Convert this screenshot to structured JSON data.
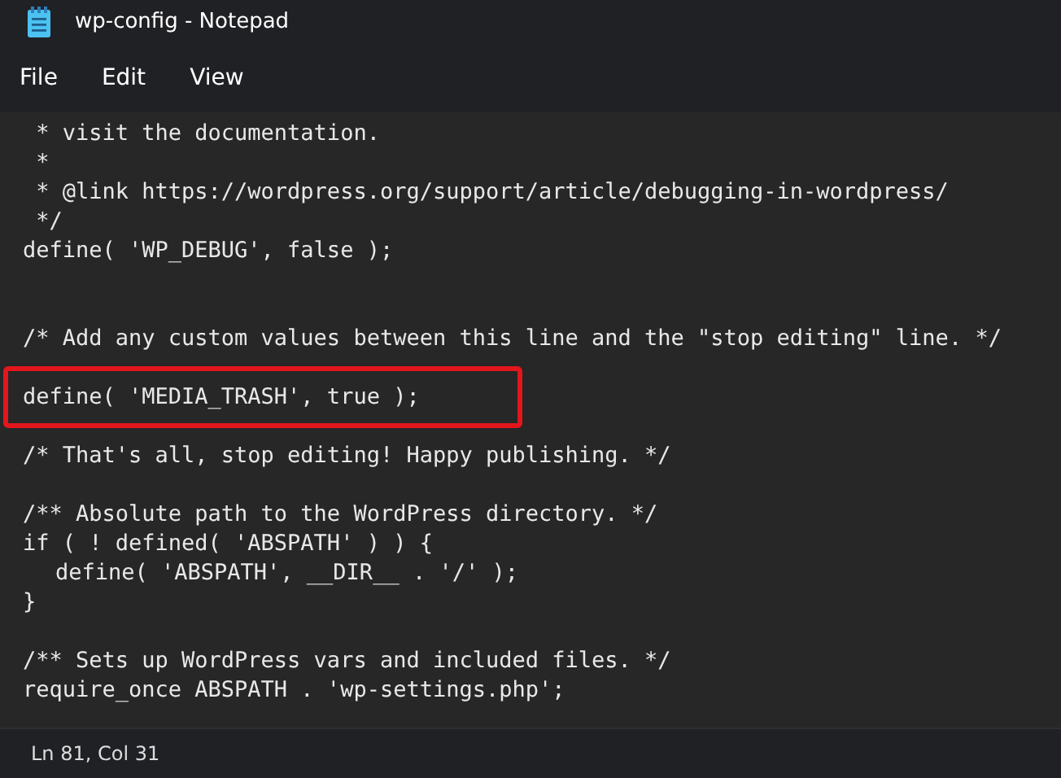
{
  "window": {
    "title": "wp-config - Notepad"
  },
  "menu": [
    "File",
    "Edit",
    "View"
  ],
  "editor": {
    "lines": [
      {
        "kind": "code",
        "text": " * visit the documentation.",
        "highlighted": false
      },
      {
        "kind": "code",
        "text": " *",
        "highlighted": false
      },
      {
        "kind": "code",
        "text": " * @link https://wordpress.org/support/article/debugging-in-wordpress/",
        "highlighted": false
      },
      {
        "kind": "code",
        "text": " */",
        "highlighted": false
      },
      {
        "kind": "code",
        "text": "define( 'WP_DEBUG', false );",
        "highlighted": false
      },
      {
        "kind": "blank"
      },
      {
        "kind": "blank"
      },
      {
        "kind": "code",
        "text": "/* Add any custom values between this line and the \"stop editing\" line. */",
        "highlighted": false
      },
      {
        "kind": "blank"
      },
      {
        "kind": "code",
        "text": "define( 'MEDIA_TRASH', true );",
        "highlighted": true
      },
      {
        "kind": "blank"
      },
      {
        "kind": "code",
        "text": "/* That's all, stop editing! Happy publishing. */",
        "highlighted": false
      },
      {
        "kind": "blank"
      },
      {
        "kind": "code",
        "text": "/** Absolute path to the WordPress directory. */",
        "highlighted": false
      },
      {
        "kind": "code",
        "text": "if ( ! defined( 'ABSPATH' ) ) {",
        "highlighted": false
      },
      {
        "kind": "code",
        "text": "\tdefine( 'ABSPATH', __DIR__ . '/' );",
        "highlighted": false
      },
      {
        "kind": "code",
        "text": "}",
        "highlighted": false
      },
      {
        "kind": "blank"
      },
      {
        "kind": "code",
        "text": "/** Sets up WordPress vars and included files. */",
        "highlighted": false
      },
      {
        "kind": "code",
        "text": "require_once ABSPATH . 'wp-settings.php';",
        "highlighted": false
      }
    ]
  },
  "status_bar": {
    "position": "Ln 81, Col 31"
  }
}
